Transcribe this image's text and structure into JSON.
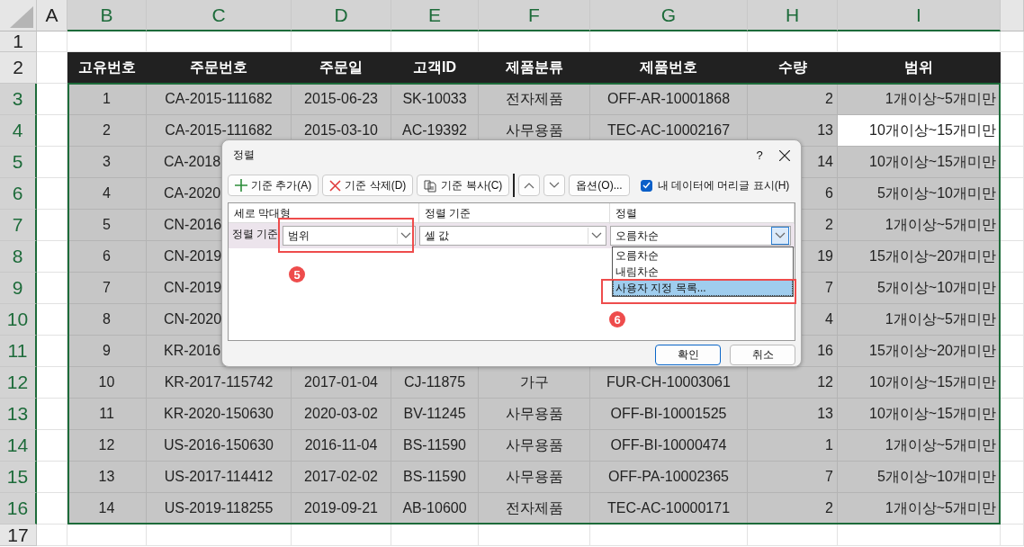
{
  "sheet": {
    "columns": [
      {
        "label": "A",
        "selected": false
      },
      {
        "label": "B",
        "selected": true
      },
      {
        "label": "C",
        "selected": true
      },
      {
        "label": "D",
        "selected": true
      },
      {
        "label": "E",
        "selected": true
      },
      {
        "label": "F",
        "selected": true
      },
      {
        "label": "G",
        "selected": true
      },
      {
        "label": "H",
        "selected": true
      },
      {
        "label": "I",
        "selected": true
      }
    ],
    "row_numbers": [
      {
        "label": "1",
        "selected": false
      },
      {
        "label": "2",
        "selected": false
      },
      {
        "label": "3",
        "selected": true
      },
      {
        "label": "4",
        "selected": true
      },
      {
        "label": "5",
        "selected": true
      },
      {
        "label": "6",
        "selected": true
      },
      {
        "label": "7",
        "selected": true
      },
      {
        "label": "8",
        "selected": true
      },
      {
        "label": "9",
        "selected": true
      },
      {
        "label": "10",
        "selected": true
      },
      {
        "label": "11",
        "selected": true
      },
      {
        "label": "12",
        "selected": true
      },
      {
        "label": "13",
        "selected": true
      },
      {
        "label": "14",
        "selected": true
      },
      {
        "label": "15",
        "selected": true
      },
      {
        "label": "16",
        "selected": true
      },
      {
        "label": "17",
        "selected": false
      }
    ],
    "header": [
      "고유번호",
      "주문번호",
      "주문일",
      "고객ID",
      "제품분류",
      "제품번호",
      "수량",
      "범위"
    ],
    "rows": [
      {
        "active": false,
        "cells": {
          "b": "1",
          "c": "CA-2015-111682",
          "d": "2015-06-23",
          "e": "SK-10033",
          "f": "전자제품",
          "g": "OFF-AR-10001868",
          "h": "2",
          "i": "1개이상~5개미만"
        }
      },
      {
        "active": true,
        "cells": {
          "b": "2",
          "c": "CA-2015-111682",
          "d": "2015-03-10",
          "e": "AC-19392",
          "f": "사무용품",
          "g": "TEC-AC-10002167",
          "h": "13",
          "i": "10개이상~15개미만"
        }
      },
      {
        "active": false,
        "cells": {
          "b": "3",
          "c": "CA-2018",
          "h": "14",
          "i": "10개이상~15개미만"
        }
      },
      {
        "active": false,
        "cells": {
          "b": "4",
          "c": "CA-2020",
          "h": "6",
          "i": "5개이상~10개미만"
        }
      },
      {
        "active": false,
        "cells": {
          "b": "5",
          "c": "CN-2016",
          "h": "2",
          "i": "1개이상~5개미만"
        }
      },
      {
        "active": false,
        "cells": {
          "b": "6",
          "c": "CN-2019",
          "h": "19",
          "i": "15개이상~20개미만"
        }
      },
      {
        "active": false,
        "cells": {
          "b": "7",
          "c": "CN-2019",
          "h": "7",
          "i": "5개이상~10개미만"
        }
      },
      {
        "active": false,
        "cells": {
          "b": "8",
          "c": "CN-2020",
          "h": "4",
          "i": "1개이상~5개미만"
        }
      },
      {
        "active": false,
        "cells": {
          "b": "9",
          "c": "KR-2016",
          "h": "16",
          "i": "15개이상~20개미만"
        }
      },
      {
        "active": false,
        "cells": {
          "b": "10",
          "c": "KR-2017-115742",
          "d": "2017-01-04",
          "e": "CJ-11875",
          "f": "가구",
          "g": "FUR-CH-10003061",
          "h": "12",
          "i": "10개이상~15개미만"
        }
      },
      {
        "active": false,
        "cells": {
          "b": "11",
          "c": "KR-2020-150630",
          "d": "2020-03-02",
          "e": "BV-11245",
          "f": "사무용품",
          "g": "OFF-BI-10001525",
          "h": "13",
          "i": "10개이상~15개미만"
        }
      },
      {
        "active": false,
        "cells": {
          "b": "12",
          "c": "US-2016-150630",
          "d": "2016-11-04",
          "e": "BS-11590",
          "f": "사무용품",
          "g": "OFF-BI-10000474",
          "h": "1",
          "i": "1개이상~5개미만"
        }
      },
      {
        "active": false,
        "cells": {
          "b": "13",
          "c": "US-2017-114412",
          "d": "2017-02-02",
          "e": "BS-11590",
          "f": "사무용품",
          "g": "OFF-PA-10002365",
          "h": "7",
          "i": "5개이상~10개미만"
        }
      },
      {
        "active": false,
        "cells": {
          "b": "14",
          "c": "US-2019-118255",
          "d": "2019-09-21",
          "e": "AB-10600",
          "f": "전자제품",
          "g": "TEC-AC-10000171",
          "h": "2",
          "i": "1개이상~5개미만"
        }
      }
    ]
  },
  "dialog": {
    "title": "정렬",
    "help": "?",
    "toolbar": [
      {
        "kind": "add",
        "label": "기준 추가(A)"
      },
      {
        "kind": "delete",
        "label": "기준 삭제(D)"
      },
      {
        "kind": "copy",
        "label": "기준 복사(C)"
      },
      {
        "kind": "up"
      },
      {
        "kind": "down"
      },
      {
        "kind": "options",
        "label": "옵션(O)..."
      }
    ],
    "header_checkbox": {
      "label": "내 데이터에 머리글 표시(H)",
      "checked": true
    },
    "list_columns": [
      "세로 막대형",
      "정렬 기준",
      "정렬"
    ],
    "level": {
      "label": "정렬 기준",
      "column": "범위",
      "sort_on": "셀 값",
      "order": "오름차순",
      "expanded": true
    },
    "order_options": [
      {
        "label": "오름차순",
        "selected": false
      },
      {
        "label": "내림차순",
        "selected": false
      },
      {
        "label": "사용자 지정 목록...",
        "selected": true
      }
    ],
    "buttons": [
      {
        "kind": "ok",
        "label": "확인"
      },
      {
        "kind": "cancel",
        "label": "취소"
      }
    ],
    "callouts": [
      "5",
      "6"
    ]
  }
}
